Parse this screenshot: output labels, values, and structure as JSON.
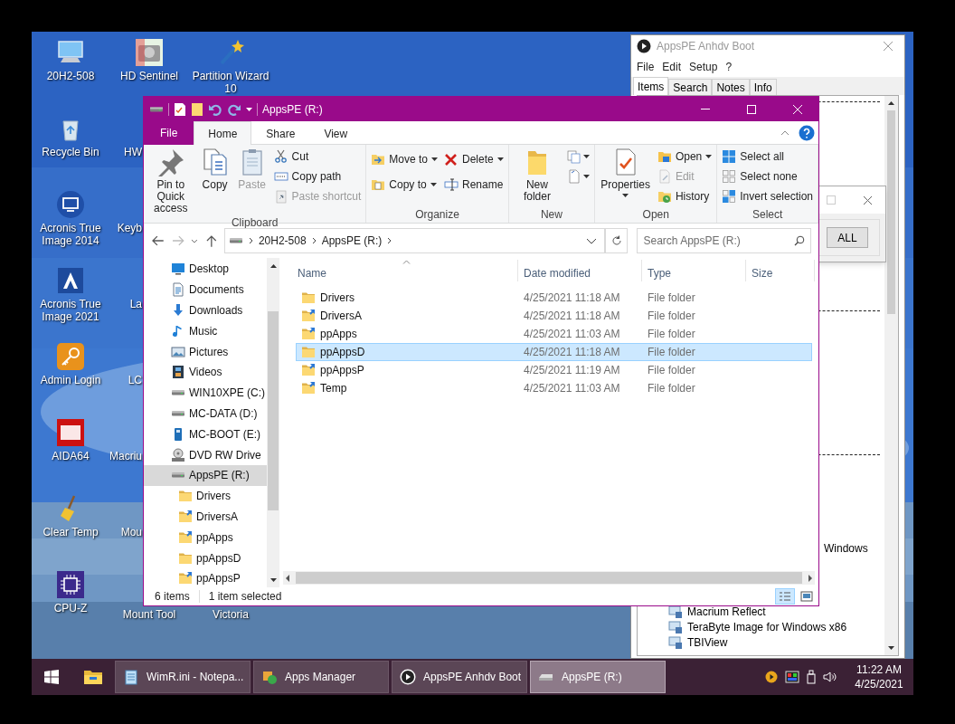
{
  "desktop": {
    "columns": [
      [
        {
          "label": "20H2-508"
        },
        {
          "label": "Recycle Bin"
        },
        {
          "label": "Acronis True Image 2014"
        },
        {
          "label": "Acronis True Image 2021"
        },
        {
          "label": "Admin Login"
        },
        {
          "label": "AIDA64"
        },
        {
          "label": "Clear Temp"
        },
        {
          "label": "CPU-Z"
        }
      ],
      [
        {
          "label": "HD Sentinel"
        },
        {
          "label": "HW"
        },
        {
          "label": "Keyb"
        },
        {
          "label": "La"
        },
        {
          "label": "LC"
        },
        {
          "label": "Macriu"
        },
        {
          "label": "Mou"
        },
        {
          "label": "Mount Tool"
        }
      ],
      [
        {
          "label": "Partition Wizard 10"
        },
        {
          "label": "Victoria"
        }
      ]
    ]
  },
  "boot_window": {
    "title": "AppsPE Anhdv Boot",
    "menu": [
      "File",
      "Edit",
      "Setup",
      "?"
    ],
    "tabs": [
      {
        "label": "Items",
        "selected": true
      },
      {
        "label": "Search",
        "selected": false
      },
      {
        "label": "Notes",
        "selected": false
      },
      {
        "label": "Info",
        "selected": false
      }
    ],
    "entries": [
      {
        "kind": "separator"
      },
      {
        "kind": "separator"
      },
      {
        "kind": "separator"
      },
      {
        "kind": "partial",
        "label": "Windows"
      },
      {
        "kind": "item",
        "label": "Macrium Reflect"
      },
      {
        "kind": "item",
        "label": "TeraByte Image for Windows x86"
      },
      {
        "kind": "item",
        "label": "TBIView"
      }
    ]
  },
  "dialog": {
    "button": "ALL"
  },
  "explorer": {
    "title": "AppsPE (R:)",
    "tabs": [
      {
        "label": "File",
        "kind": "file",
        "selected": false
      },
      {
        "label": "Home",
        "kind": "tab",
        "selected": true
      },
      {
        "label": "Share",
        "kind": "tab",
        "selected": false
      },
      {
        "label": "View",
        "kind": "tab",
        "selected": false
      }
    ],
    "groups": [
      {
        "label": "Clipboard",
        "columns": [
          [
            {
              "kind": "large",
              "label": "Pin to Quick access",
              "disabled": false,
              "dropdown": false
            }
          ],
          [
            {
              "kind": "large",
              "label": "Copy",
              "disabled": false,
              "dropdown": false
            }
          ],
          [
            {
              "kind": "large",
              "label": "Paste",
              "disabled": true,
              "dropdown": false
            }
          ],
          [
            {
              "kind": "small",
              "label": "Cut",
              "disabled": false,
              "dropdown": false
            },
            {
              "kind": "small",
              "label": "Copy path",
              "disabled": false,
              "dropdown": false
            },
            {
              "kind": "small",
              "label": "Paste shortcut",
              "disabled": true,
              "dropdown": false
            }
          ]
        ]
      },
      {
        "label": "Organize",
        "columns": [
          [
            {
              "kind": "small",
              "label": "Move to",
              "disabled": false,
              "dropdown": true
            },
            {
              "kind": "small",
              "label": "Copy to",
              "disabled": false,
              "dropdown": true
            }
          ],
          [
            {
              "kind": "small",
              "label": "Delete",
              "disabled": false,
              "dropdown": true
            },
            {
              "kind": "small",
              "label": "Rename",
              "disabled": false,
              "dropdown": false
            }
          ]
        ]
      },
      {
        "label": "New",
        "columns": [
          [
            {
              "kind": "large",
              "label": "New folder",
              "disabled": false,
              "dropdown": false
            }
          ],
          [
            {
              "kind": "icon",
              "disabled": false,
              "dropdown": true
            },
            {
              "kind": "icon",
              "disabled": false,
              "dropdown": true
            }
          ]
        ]
      },
      {
        "label": "Open",
        "columns": [
          [
            {
              "kind": "large",
              "label": "Properties",
              "disabled": false,
              "dropdown": true
            }
          ],
          [
            {
              "kind": "small",
              "label": "Open",
              "disabled": false,
              "dropdown": true
            },
            {
              "kind": "small",
              "label": "Edit",
              "disabled": true,
              "dropdown": false
            },
            {
              "kind": "small",
              "label": "History",
              "disabled": false,
              "dropdown": false
            }
          ]
        ]
      },
      {
        "label": "Select",
        "columns": [
          [
            {
              "kind": "small",
              "label": "Select all",
              "disabled": false,
              "dropdown": false
            },
            {
              "kind": "small",
              "label": "Select none",
              "disabled": false,
              "dropdown": false
            },
            {
              "kind": "small",
              "label": "Invert selection",
              "disabled": false,
              "dropdown": false
            }
          ]
        ]
      }
    ],
    "path": [
      "20H2-508",
      "AppsPE (R:)"
    ],
    "search": {
      "placeholder": "Search AppsPE (R:)"
    },
    "nav": [
      {
        "label": "Desktop",
        "kind": "desktop",
        "selected": false
      },
      {
        "label": "Documents",
        "kind": "documents",
        "selected": false
      },
      {
        "label": "Downloads",
        "kind": "downloads",
        "selected": false
      },
      {
        "label": "Music",
        "kind": "music",
        "selected": false
      },
      {
        "label": "Pictures",
        "kind": "pictures",
        "selected": false
      },
      {
        "label": "Videos",
        "kind": "videos",
        "selected": false
      },
      {
        "label": "WIN10XPE (C:)",
        "kind": "drive",
        "selected": false
      },
      {
        "label": "MC-DATA (D:)",
        "kind": "drive",
        "selected": false
      },
      {
        "label": "MC-BOOT (E:)",
        "kind": "usb",
        "selected": false
      },
      {
        "label": "DVD RW Drive",
        "kind": "dvd",
        "selected": false
      },
      {
        "label": "AppsPE (R:)",
        "kind": "drive",
        "selected": true,
        "children": [
          {
            "label": "Drivers",
            "kind": "folder",
            "selected": false
          },
          {
            "label": "DriversA",
            "kind": "linked-folder",
            "selected": false
          },
          {
            "label": "ppApps",
            "kind": "linked-folder",
            "selected": false
          },
          {
            "label": "ppAppsD",
            "kind": "folder",
            "selected": false
          },
          {
            "label": "ppAppsP",
            "kind": "linked-folder",
            "selected": false
          }
        ]
      }
    ],
    "columns": [
      "Name",
      "Date modified",
      "Type",
      "Size"
    ],
    "rows": [
      {
        "name": "Drivers",
        "kind": "folder",
        "date": "4/25/2021 11:18 AM",
        "type": "File folder",
        "selected": false
      },
      {
        "name": "DriversA",
        "kind": "linked-folder",
        "date": "4/25/2021 11:18 AM",
        "type": "File folder",
        "selected": false
      },
      {
        "name": "ppApps",
        "kind": "linked-folder",
        "date": "4/25/2021 11:03 AM",
        "type": "File folder",
        "selected": false
      },
      {
        "name": "ppAppsD",
        "kind": "folder",
        "date": "4/25/2021 11:18 AM",
        "type": "File folder",
        "selected": true
      },
      {
        "name": "ppAppsP",
        "kind": "linked-folder",
        "date": "4/25/2021 11:19 AM",
        "type": "File folder",
        "selected": false
      },
      {
        "name": "Temp",
        "kind": "linked-folder",
        "date": "4/25/2021 11:03 AM",
        "type": "File folder",
        "selected": false
      }
    ],
    "status": {
      "count": "6 items",
      "selection": "1 item selected"
    },
    "views": [
      {
        "kind": "details",
        "selected": true
      },
      {
        "kind": "large-icons",
        "selected": false
      }
    ]
  },
  "taskbar": {
    "buttons": [
      {
        "label": "WimR.ini - Notepa...",
        "kind": "notepad",
        "selected": false
      },
      {
        "label": "Apps Manager",
        "kind": "apps",
        "selected": false
      },
      {
        "label": "AppsPE Anhdv Boot",
        "kind": "player",
        "selected": false
      },
      {
        "label": "AppsPE (R:)",
        "kind": "drive",
        "selected": true
      }
    ],
    "time": "11:22 AM",
    "date": "4/25/2021"
  }
}
